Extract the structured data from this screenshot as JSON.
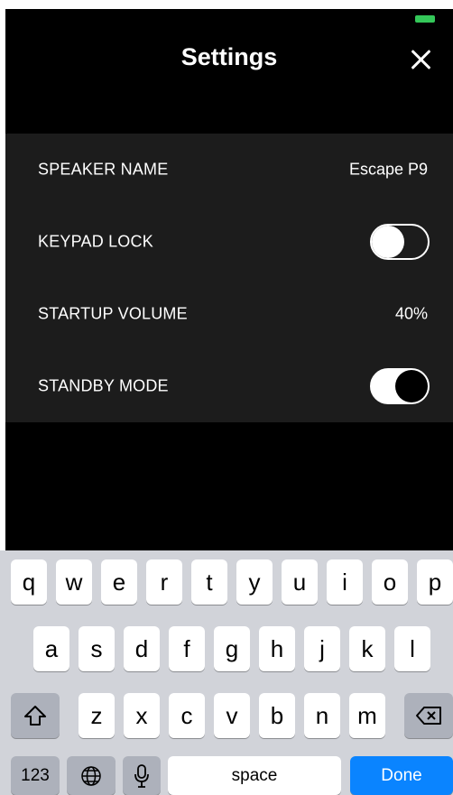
{
  "header": {
    "title": "Settings"
  },
  "settings": {
    "speaker_name_label": "SPEAKER NAME",
    "speaker_name_value": "Escape P9",
    "keypad_lock_label": "KEYPAD LOCK",
    "startup_volume_label": "STARTUP VOLUME",
    "startup_volume_value": "40%",
    "standby_mode_label": "STANDBY MODE"
  },
  "toggles": {
    "keypad_lock": "off",
    "standby_mode": "on"
  },
  "keyboard": {
    "row1": [
      "q",
      "w",
      "e",
      "r",
      "t",
      "y",
      "u",
      "i",
      "o",
      "p"
    ],
    "row2": [
      "a",
      "s",
      "d",
      "f",
      "g",
      "h",
      "j",
      "k",
      "l"
    ],
    "row3": [
      "z",
      "x",
      "c",
      "v",
      "b",
      "n",
      "m"
    ],
    "numbers_label": "123",
    "space_label": "space",
    "done_label": "Done"
  },
  "colors": {
    "accent": "#0a84ff",
    "battery": "#34c759",
    "panel": "#1c1c1c"
  }
}
